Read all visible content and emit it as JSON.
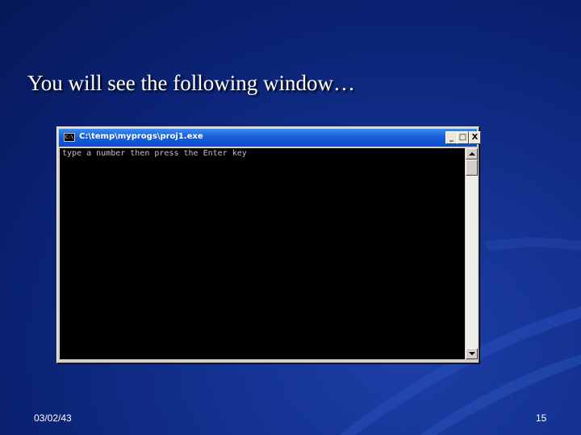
{
  "slide": {
    "title": "You will see the following window…",
    "date": "03/02/43",
    "page_number": "15"
  },
  "console_window": {
    "title": "C:\\temp\\myprogs\\proj1.exe",
    "icon_text": "C:\\",
    "output_text": "type a number then press the Enter key",
    "minimize_label": "_",
    "maximize_label": "□",
    "close_label": "X"
  },
  "icons": [
    "console-app-icon",
    "scroll-up-arrow-icon",
    "scroll-down-arrow-icon"
  ],
  "colors": {
    "slide_background": "#0b2375",
    "titlebar": "#1a5fd8",
    "console_background": "#000000",
    "console_text": "#c0c0c0"
  }
}
